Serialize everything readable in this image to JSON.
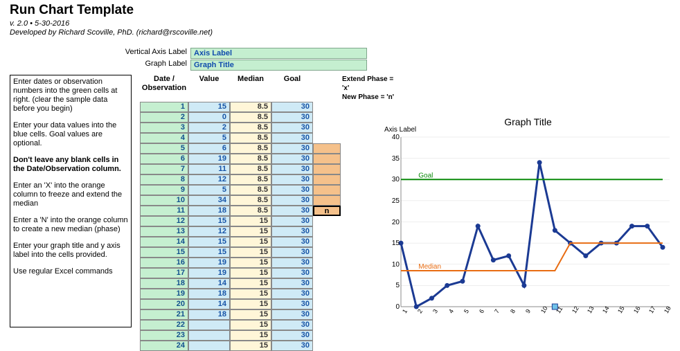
{
  "header": {
    "title": "Run Chart Template",
    "version": "v. 2.0 • 5-30-2016",
    "author": "Developed by Richard Scoville, PhD. (richard@rscoville.net)"
  },
  "labels": {
    "vertical_cap": "Vertical Axis Label",
    "vertical_val": "Axis Label",
    "graph_cap": "Graph Label",
    "graph_val": "Graph Title"
  },
  "columns": {
    "date": "Date / Observation",
    "value": "Value",
    "median": "Median",
    "goal": "Goal",
    "extend": "Extend Phase  = 'x'",
    "newp": "New Phase = 'n'"
  },
  "instructions": {
    "p1": "Enter dates or observation numbers into the green cells at right. (clear the sample data before you begin)",
    "p2": "Enter your data values into the blue cells. Goal values are optional.",
    "p3": "Don't leave any blank cells in the Date/Observation column.",
    "p4": "Enter an 'X' into the orange column to freeze and extend the median",
    "p5": "Enter a 'N' into the orange column to create a new median (phase)",
    "p6": "Enter your graph title and y axis label into the cells provided.",
    "p7": "Use regular Excel commands"
  },
  "rows": [
    {
      "date": "1",
      "value": "15",
      "median": "8.5",
      "goal": "30",
      "phase": ""
    },
    {
      "date": "2",
      "value": "0",
      "median": "8.5",
      "goal": "30",
      "phase": ""
    },
    {
      "date": "3",
      "value": "2",
      "median": "8.5",
      "goal": "30",
      "phase": ""
    },
    {
      "date": "4",
      "value": "5",
      "median": "8.5",
      "goal": "30",
      "phase": ""
    },
    {
      "date": "5",
      "value": "6",
      "median": "8.5",
      "goal": "30",
      "phase": ""
    },
    {
      "date": "6",
      "value": "19",
      "median": "8.5",
      "goal": "30",
      "phase": ""
    },
    {
      "date": "7",
      "value": "11",
      "median": "8.5",
      "goal": "30",
      "phase": ""
    },
    {
      "date": "8",
      "value": "12",
      "median": "8.5",
      "goal": "30",
      "phase": ""
    },
    {
      "date": "9",
      "value": "5",
      "median": "8.5",
      "goal": "30",
      "phase": ""
    },
    {
      "date": "10",
      "value": "34",
      "median": "8.5",
      "goal": "30",
      "phase": ""
    },
    {
      "date": "11",
      "value": "18",
      "median": "8.5",
      "goal": "30",
      "phase": "n"
    },
    {
      "date": "12",
      "value": "15",
      "median": "15",
      "goal": "30",
      "phase": ""
    },
    {
      "date": "13",
      "value": "12",
      "median": "15",
      "goal": "30",
      "phase": ""
    },
    {
      "date": "14",
      "value": "15",
      "median": "15",
      "goal": "30",
      "phase": ""
    },
    {
      "date": "15",
      "value": "15",
      "median": "15",
      "goal": "30",
      "phase": ""
    },
    {
      "date": "16",
      "value": "19",
      "median": "15",
      "goal": "30",
      "phase": ""
    },
    {
      "date": "17",
      "value": "19",
      "median": "15",
      "goal": "30",
      "phase": ""
    },
    {
      "date": "18",
      "value": "14",
      "median": "15",
      "goal": "30",
      "phase": ""
    },
    {
      "date": "19",
      "value": "18",
      "median": "15",
      "goal": "30",
      "phase": ""
    },
    {
      "date": "20",
      "value": "14",
      "median": "15",
      "goal": "30",
      "phase": ""
    },
    {
      "date": "21",
      "value": "18",
      "median": "15",
      "goal": "30",
      "phase": ""
    },
    {
      "date": "22",
      "value": "",
      "median": "15",
      "goal": "30",
      "phase": ""
    },
    {
      "date": "23",
      "value": "",
      "median": "15",
      "goal": "30",
      "phase": ""
    },
    {
      "date": "24",
      "value": "",
      "median": "15",
      "goal": "30",
      "phase": ""
    }
  ],
  "chart_data": {
    "type": "line",
    "title": "Graph Title",
    "ylabel": "Axis Label",
    "xlabel": "",
    "ylim": [
      0,
      40
    ],
    "yticks": [
      0,
      5,
      10,
      15,
      20,
      25,
      30,
      35,
      40
    ],
    "x": [
      1,
      2,
      3,
      4,
      5,
      6,
      7,
      8,
      9,
      10,
      11,
      12,
      13,
      14,
      15,
      16,
      17,
      18
    ],
    "series": [
      {
        "name": "Value",
        "color": "#1b3a93",
        "values": [
          15,
          0,
          2,
          5,
          6,
          19,
          11,
          12,
          5,
          34,
          18,
          15,
          12,
          15,
          15,
          19,
          19,
          14
        ]
      },
      {
        "name": "Median",
        "color": "#e86c12",
        "values": [
          8.5,
          8.5,
          8.5,
          8.5,
          8.5,
          8.5,
          8.5,
          8.5,
          8.5,
          8.5,
          8.5,
          15,
          15,
          15,
          15,
          15,
          15,
          15
        ]
      },
      {
        "name": "Goal",
        "color": "#0a8a0a",
        "values": [
          30,
          30,
          30,
          30,
          30,
          30,
          30,
          30,
          30,
          30,
          30,
          30,
          30,
          30,
          30,
          30,
          30,
          30
        ]
      }
    ],
    "annotations": [
      {
        "text": "Goal",
        "x": 2,
        "y": 30
      },
      {
        "text": "Median",
        "x": 2,
        "y": 8.5
      }
    ],
    "marker": {
      "x": 11,
      "y": 0
    }
  }
}
